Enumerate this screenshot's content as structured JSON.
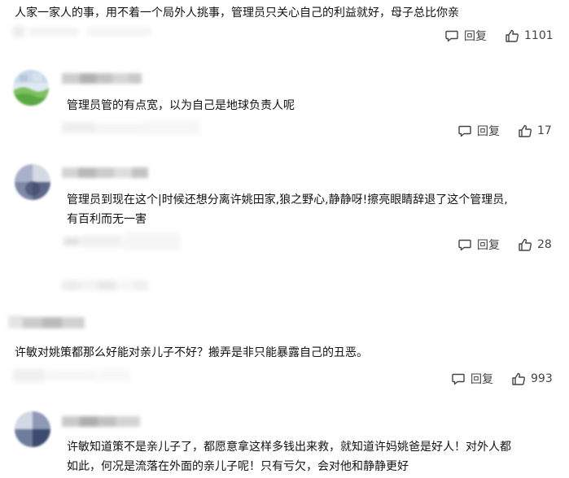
{
  "comments": [
    {
      "text": "人家一家人的事，用不着一个局外人挑事，管理员只关心自己的利益就好，母子总比你亲",
      "reply_label": "回复",
      "like_count": "1101",
      "reply_icon": "comment-bubble-icon",
      "like_icon": "thumbs-up-icon"
    },
    {
      "text": "管理员管的有点宽，以为自己是地球负责人呢",
      "reply_label": "回复",
      "like_count": "17",
      "reply_icon": "comment-bubble-icon",
      "like_icon": "thumbs-up-icon"
    },
    {
      "text": "管理员到现在这个|时候还想分离许姚田家,狼之野心,静静呀!擦亮眼睛辞退了这个管理员,有百利而无一害",
      "line1": "管理员到现在这个|时候还想分离许姚田家,狼之野心,静静呀!擦亮眼睛辞退了这个管理员,",
      "line2": "有百利而无一害",
      "reply_label": "回复",
      "like_count": "28",
      "reply_icon": "comment-bubble-icon",
      "like_icon": "thumbs-up-icon"
    },
    {
      "text": "许敏对姚策都那么好能对亲儿子不好？搬弄是非只能暴露自己的丑恶。",
      "reply_label": "回复",
      "like_count": "993",
      "reply_icon": "comment-bubble-icon",
      "like_icon": "thumbs-up-icon"
    },
    {
      "text": "许敏知道策不是亲儿子了，都愿意拿这样多钱出来救，就知道许妈姚爸是好人！对外人都如此，何况是流落在外面的亲儿子呢！只有亏欠，会对他和静静更好",
      "line1": "许敏知道策不是亲儿子了，都愿意拿这样多钱出来救，就知道许妈姚爸是好人！对外人都",
      "line2": "如此，何况是流落在外面的亲儿子呢！只有亏欠，会对他和静静更好"
    }
  ],
  "colors": {
    "text": "#121212",
    "action": "#444444",
    "mosaic_light": "#e6e6e6",
    "mosaic_mid": "#cfcfcf",
    "mosaic_dark": "#9a9a9a"
  }
}
